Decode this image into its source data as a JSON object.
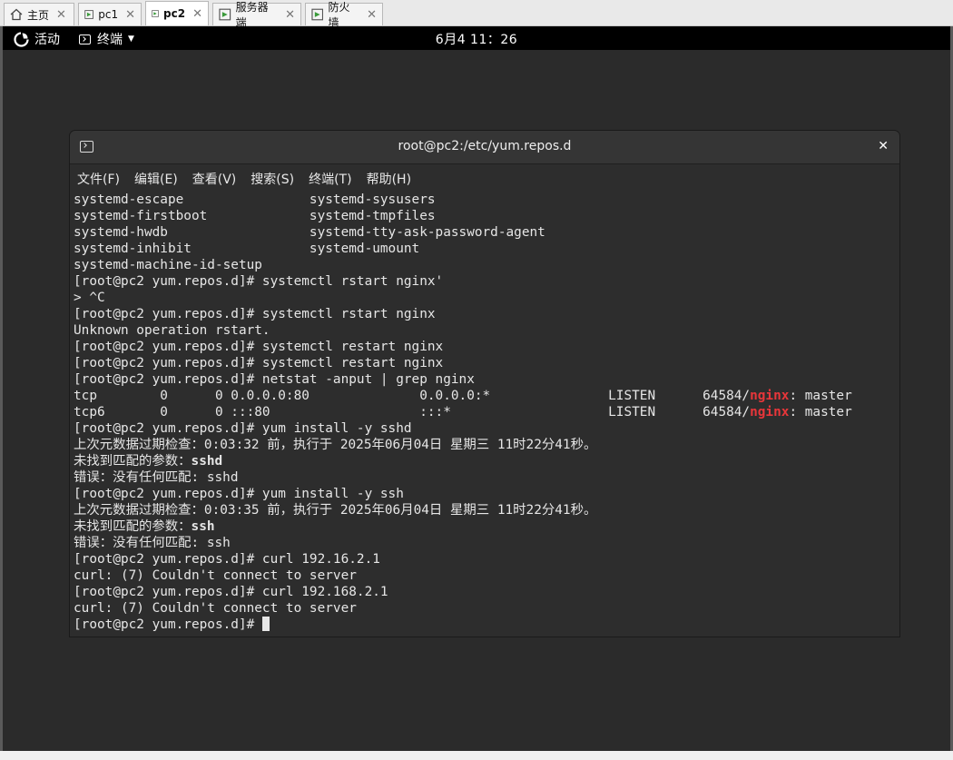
{
  "vm_tabs": [
    {
      "label": "主页",
      "icon": "home-icon"
    },
    {
      "label": "pc1",
      "icon": "vm-icon"
    },
    {
      "label": "pc2",
      "icon": "vm-icon",
      "active": true
    },
    {
      "label": "服务器端",
      "icon": "vm-icon"
    },
    {
      "label": "防火墙",
      "icon": "vm-icon"
    }
  ],
  "gnome_bar": {
    "activities": "活动",
    "app_name": "终端",
    "clock": "6月4 11：26"
  },
  "terminal": {
    "title": "root@pc2:/etc/yum.repos.d",
    "close": "✕",
    "menus": [
      "文件(F)",
      "编辑(E)",
      "查看(V)",
      "搜索(S)",
      "终端(T)",
      "帮助(H)"
    ],
    "lines": [
      "systemd-escape                systemd-sysusers",
      "systemd-firstboot             systemd-tmpfiles",
      "systemd-hwdb                  systemd-tty-ask-password-agent",
      "systemd-inhibit               systemd-umount",
      "systemd-machine-id-setup",
      "[root@pc2 yum.repos.d]# systemctl rstart nginx'",
      "> ^C",
      "[root@pc2 yum.repos.d]# systemctl rstart nginx",
      "Unknown operation rstart.",
      "[root@pc2 yum.repos.d]# systemctl restart nginx",
      "[root@pc2 yum.repos.d]# systemctl restart nginx",
      "[root@pc2 yum.repos.d]# netstat -anput | grep nginx"
    ],
    "netstat_rows": [
      {
        "pre": "tcp        0      0 0.0.0.0:80              0.0.0.0:*               LISTEN      64584/",
        "match": "nginx",
        "post": ": master"
      },
      {
        "pre": "tcp6       0      0 :::80                   :::*                    LISTEN      64584/",
        "match": "nginx",
        "post": ": master"
      }
    ],
    "lines2": [
      "[root@pc2 yum.repos.d]# yum install -y sshd",
      "上次元数据过期检查：0:03:32 前，执行于 2025年06月04日 星期三 11时22分41秒。"
    ],
    "nomatch1_label": "未找到匹配的参数：",
    "nomatch1_pkg": "sshd",
    "lines3": [
      "错误：没有任何匹配: sshd",
      "[root@pc2 yum.repos.d]# yum install -y ssh",
      "上次元数据过期检查：0:03:35 前，执行于 2025年06月04日 星期三 11时22分41秒。"
    ],
    "nomatch2_label": "未找到匹配的参数：",
    "nomatch2_pkg": "ssh",
    "lines4": [
      "错误：没有任何匹配: ssh",
      "[root@pc2 yum.repos.d]# curl 192.16.2.1",
      "curl: (7) Couldn't connect to server",
      "[root@pc2 yum.repos.d]# curl 192.168.2.1",
      "curl: (7) Couldn't connect to server"
    ],
    "prompt": "[root@pc2 yum.repos.d]# "
  },
  "colors": {
    "match_highlight": "#e8363a",
    "terminal_bg": "#2d2d2d"
  }
}
